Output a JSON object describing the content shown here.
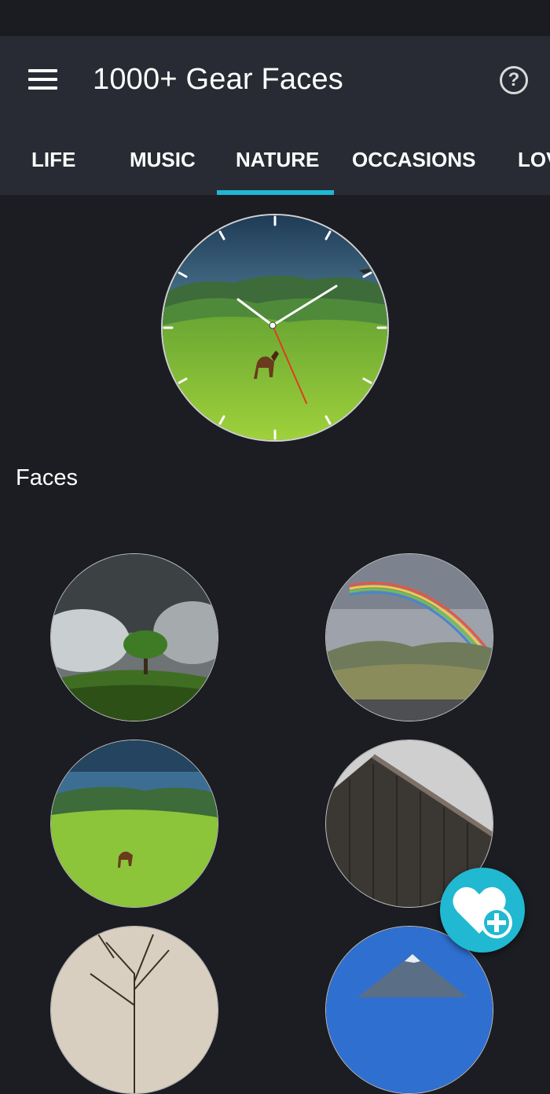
{
  "app": {
    "title": "1000+ Gear Faces",
    "help_symbol": "?"
  },
  "tabs": [
    {
      "label": "LIFE",
      "selected": false
    },
    {
      "label": "MUSIC",
      "selected": false
    },
    {
      "label": "NATURE",
      "selected": true
    },
    {
      "label": "OCCASIONS",
      "selected": false
    },
    {
      "label": "LOVE",
      "selected": false
    }
  ],
  "section": {
    "faces_label": "Faces"
  },
  "preview": {
    "clock_hands": "clock",
    "theme": "nature-meadow-horse"
  },
  "faces": [
    {
      "name": "tree-storm-face"
    },
    {
      "name": "rainbow-mountain-face"
    },
    {
      "name": "meadow-horse-face"
    },
    {
      "name": "old-barn-face"
    },
    {
      "name": "bare-tree-face"
    },
    {
      "name": "blue-mountain-face"
    }
  ],
  "colors": {
    "accent": "#1fb8d3",
    "background": "#1b1d22",
    "appbar": "#282b33",
    "fab": "#20b9d1"
  }
}
